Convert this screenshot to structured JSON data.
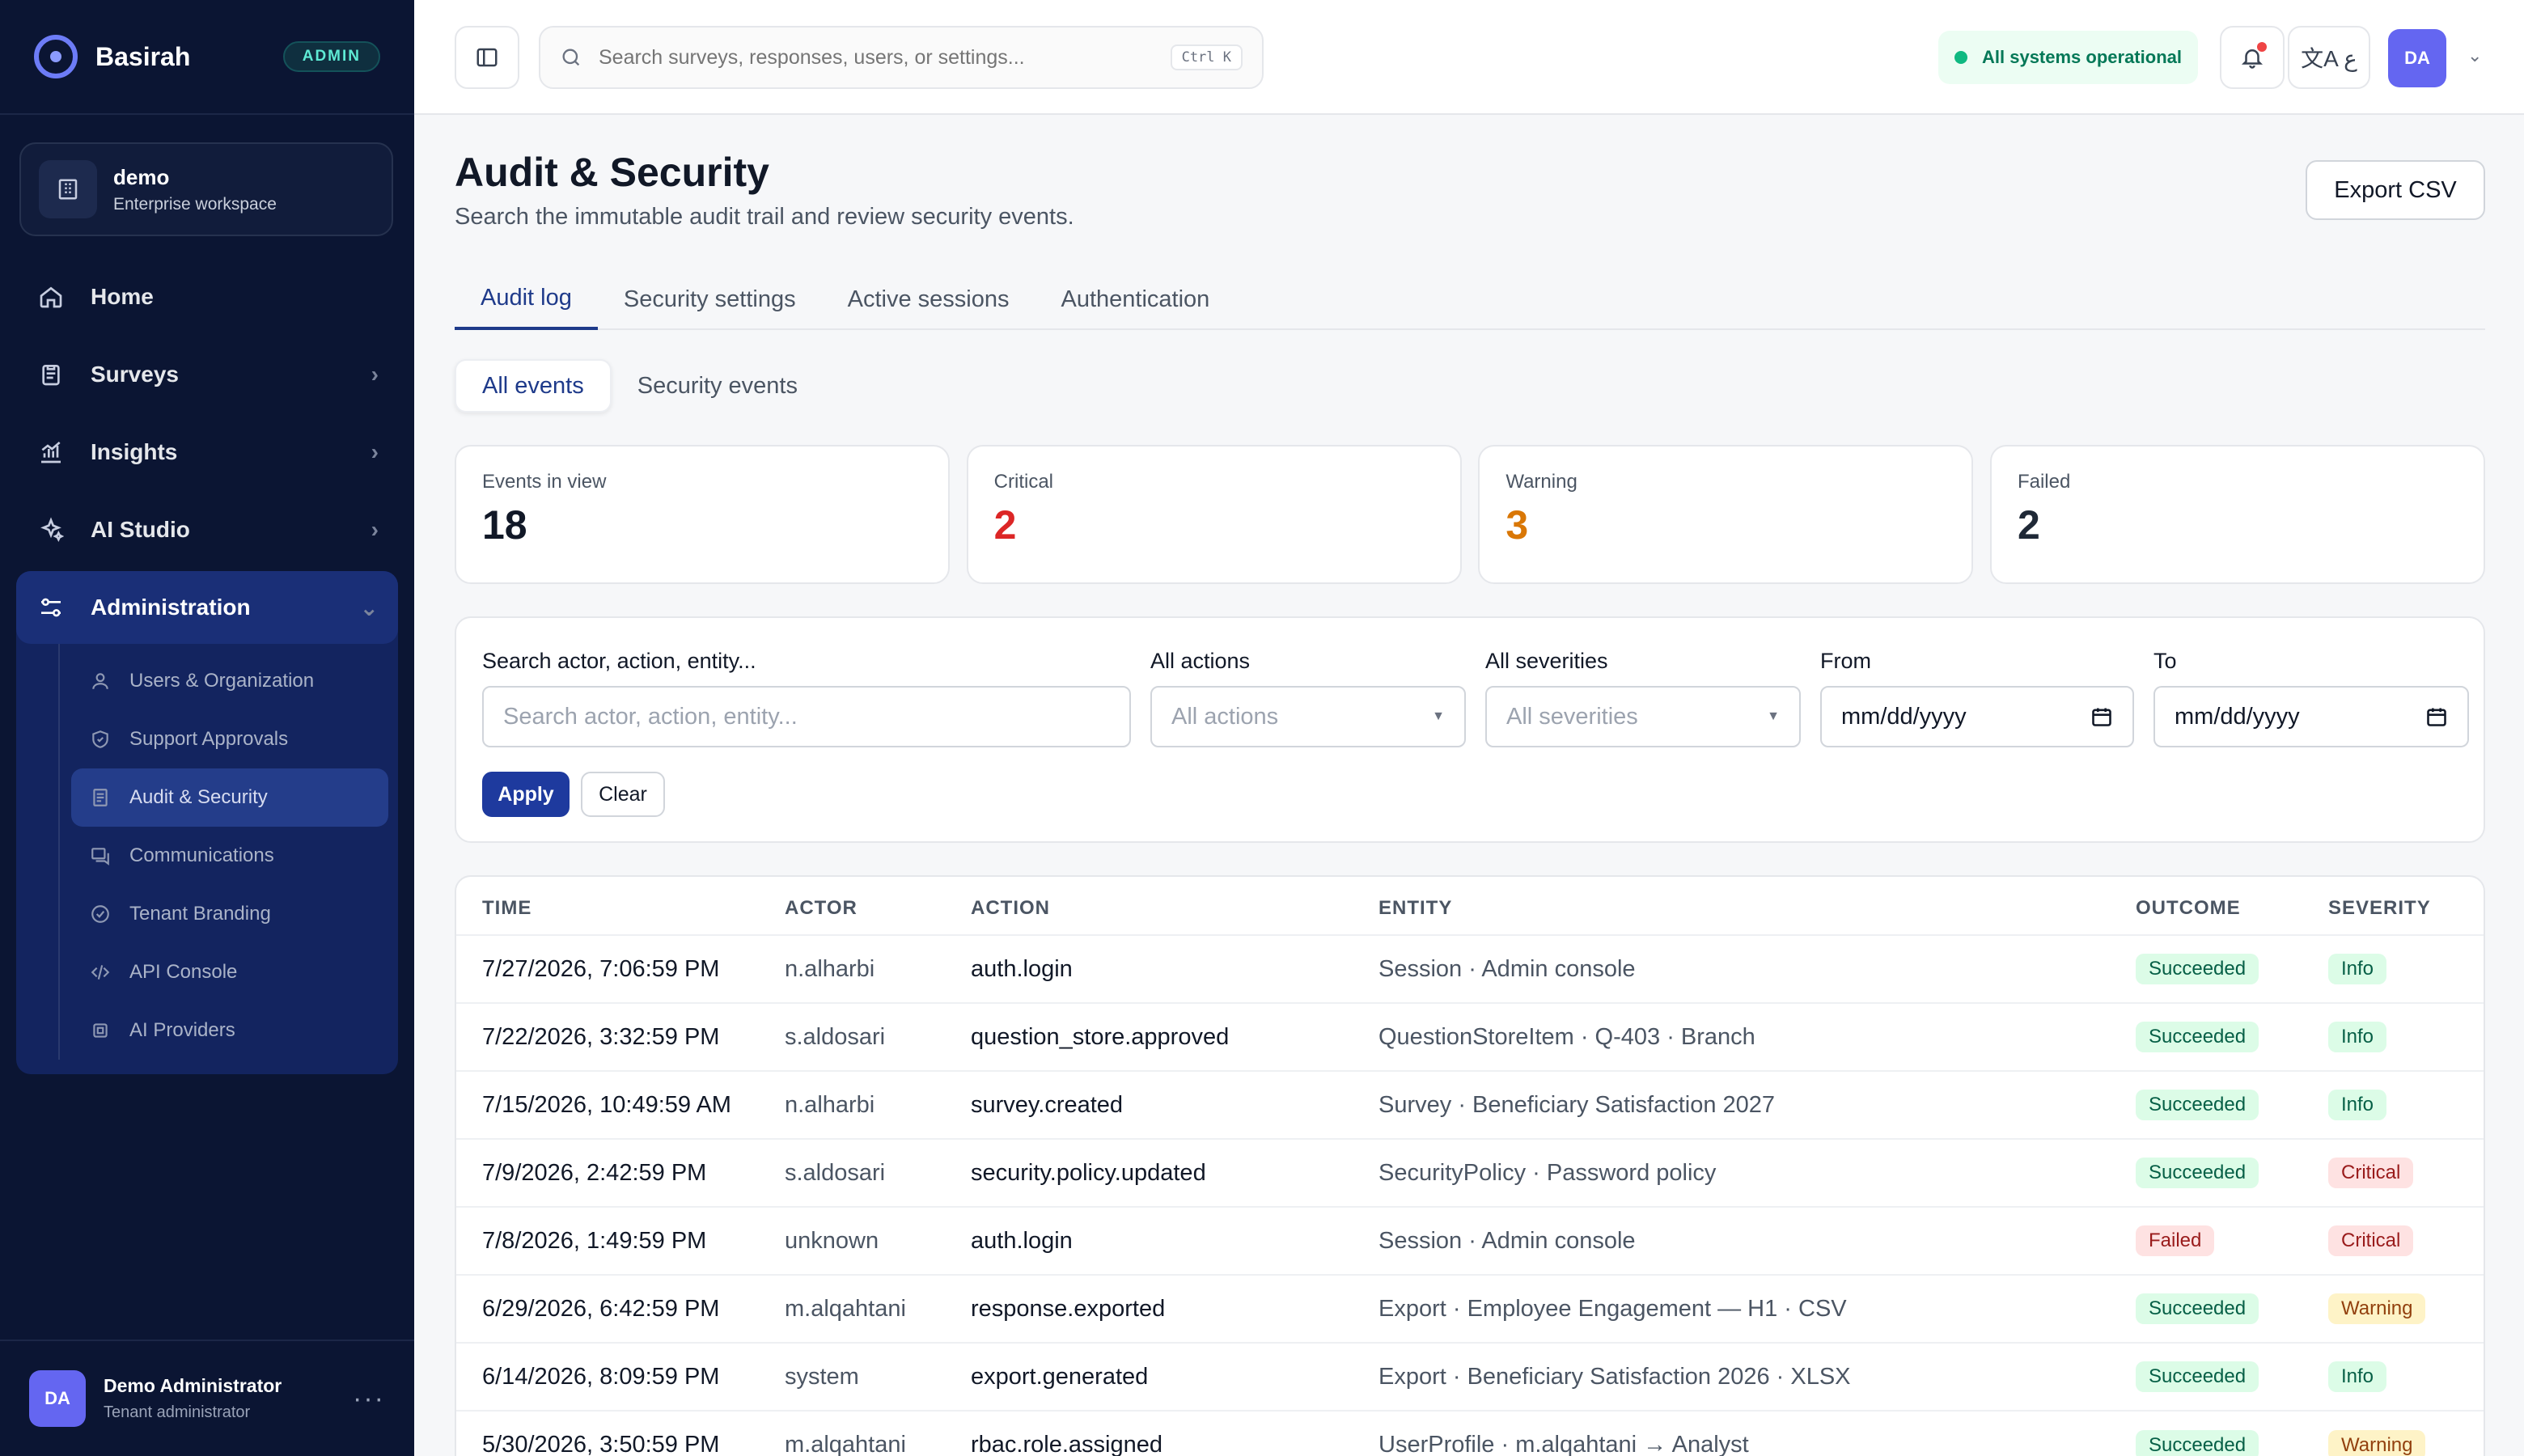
{
  "sidebar": {
    "brand": "Basirah",
    "badge": "ADMIN",
    "workspace": {
      "name": "demo",
      "subtitle": "Enterprise workspace"
    },
    "nav": [
      {
        "label": "Home",
        "icon": "home-icon",
        "chevron": ""
      },
      {
        "label": "Surveys",
        "icon": "clipboard-icon",
        "chevron": "›"
      },
      {
        "label": "Insights",
        "icon": "chart-icon",
        "chevron": "›"
      },
      {
        "label": "AI Studio",
        "icon": "sparkles-icon",
        "chevron": "›"
      }
    ],
    "admin": {
      "label": "Administration",
      "chevron": "⌄",
      "items": [
        {
          "label": "Users & Organization",
          "icon": "users-icon"
        },
        {
          "label": "Support Approvals",
          "icon": "shield-icon"
        },
        {
          "label": "Audit & Security",
          "icon": "document-icon",
          "active": true
        },
        {
          "label": "Communications",
          "icon": "message-icon"
        },
        {
          "label": "Tenant Branding",
          "icon": "check-circle-icon"
        },
        {
          "label": "API Console",
          "icon": "code-icon"
        },
        {
          "label": "AI Providers",
          "icon": "chip-icon"
        }
      ]
    },
    "user": {
      "initials": "DA",
      "name": "Demo Administrator",
      "role": "Tenant administrator",
      "more": "···"
    }
  },
  "topbar": {
    "search_placeholder": "Search surveys, responses, users, or settings...",
    "shortcut": "Ctrl K",
    "status": "All systems operational",
    "lang_glyph": "文A ع",
    "avatar": "DA",
    "caret": "⌄"
  },
  "page": {
    "title": "Audit & Security",
    "subtitle": "Search the immutable audit trail and review security events.",
    "export_label": "Export CSV",
    "tabs": [
      "Audit log",
      "Security settings",
      "Active sessions",
      "Authentication"
    ],
    "segments": [
      "All events",
      "Security events"
    ]
  },
  "stats": [
    {
      "label": "Events in view",
      "value": "18",
      "color": "#111827"
    },
    {
      "label": "Critical",
      "value": "2",
      "color": "#dc2626"
    },
    {
      "label": "Warning",
      "value": "3",
      "color": "#d97706"
    },
    {
      "label": "Failed",
      "value": "2",
      "color": "#1f2937"
    }
  ],
  "filters": {
    "search_label": "Search actor, action, entity...",
    "search_placeholder": "Search actor, action, entity...",
    "actions_label": "All actions",
    "actions_value": "All actions",
    "severities_label": "All severities",
    "severities_value": "All severities",
    "from_label": "From",
    "from_value": "mm/dd/yyyy",
    "to_label": "To",
    "to_value": "mm/dd/yyyy",
    "apply": "Apply",
    "clear": "Clear"
  },
  "table": {
    "headers": [
      "TIME",
      "ACTOR",
      "ACTION",
      "ENTITY",
      "OUTCOME",
      "SEVERITY"
    ],
    "rows": [
      {
        "time": "7/27/2026, 7:06:59 PM",
        "actor": "n.alharbi",
        "action": "auth.login",
        "entity": "Session · Admin console",
        "outcome": "Succeeded",
        "severity": "Info"
      },
      {
        "time": "7/22/2026, 3:32:59 PM",
        "actor": "s.aldosari",
        "action": "question_store.approved",
        "entity": "QuestionStoreItem · Q-403 · Branch",
        "outcome": "Succeeded",
        "severity": "Info"
      },
      {
        "time": "7/15/2026, 10:49:59 AM",
        "actor": "n.alharbi",
        "action": "survey.created",
        "entity": "Survey · Beneficiary Satisfaction 2027",
        "outcome": "Succeeded",
        "severity": "Info"
      },
      {
        "time": "7/9/2026, 2:42:59 PM",
        "actor": "s.aldosari",
        "action": "security.policy.updated",
        "entity": "SecurityPolicy · Password policy",
        "outcome": "Succeeded",
        "severity": "Critical"
      },
      {
        "time": "7/8/2026, 1:49:59 PM",
        "actor": "unknown",
        "action": "auth.login",
        "entity": "Session · Admin console",
        "outcome": "Failed",
        "severity": "Critical"
      },
      {
        "time": "6/29/2026, 6:42:59 PM",
        "actor": "m.alqahtani",
        "action": "response.exported",
        "entity": "Export · Employee Engagement — H1 · CSV",
        "outcome": "Succeeded",
        "severity": "Warning"
      },
      {
        "time": "6/14/2026, 8:09:59 PM",
        "actor": "system",
        "action": "export.generated",
        "entity": "Export · Beneficiary Satisfaction 2026 · XLSX",
        "outcome": "Succeeded",
        "severity": "Info"
      },
      {
        "time": "5/30/2026, 3:50:59 PM",
        "actor": "m.alqahtani",
        "action": "rbac.role.assigned",
        "entity": "UserProfile · m.alqahtani → Analyst",
        "outcome": "Succeeded",
        "severity": "Warning"
      }
    ]
  }
}
